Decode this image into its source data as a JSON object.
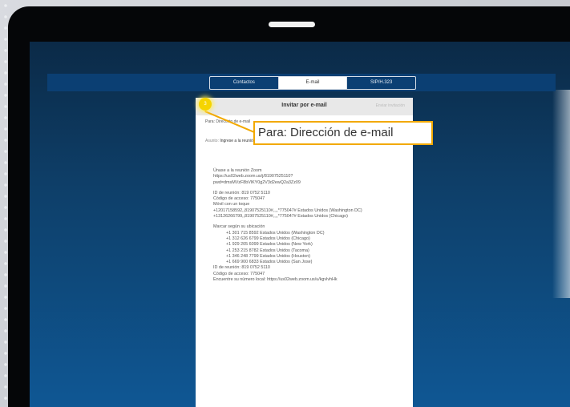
{
  "tabs": [
    "Contactos",
    "E-mail",
    "SIP/H.323"
  ],
  "active_tab": "E-mail",
  "dialog": {
    "title": "Invitar por e-mail",
    "action": "Enviar invitación",
    "to_label": "Para:",
    "to_placeholder": "Dirección de e-mail",
    "subject_label": "Asunto:",
    "subject_value": "Ingrese a la reunión Zoom"
  },
  "step_badge": "3",
  "callout": "Para: Dirección de e-mail",
  "message": {
    "p1": [
      "Únase a la reunión Zoom",
      "https://us02web.zoom.us/j/81907525110?",
      "pwd=dmsMVzF8bVlKY0g2V3d2ewQ2a3Zz09"
    ],
    "p2": [
      "ID de reunión: 819 0752 5110",
      "Código de acceso: 775047",
      "Móvil con un toque",
      "+12017158592,,81907525110#,,,,*775047# Estados Unidos (Washington DC)",
      "+13126266799,,81907525110#,,,,*775047# Estados Unidos (Chicago)"
    ],
    "p3_head": "Marcar según su ubicación",
    "p3_numbers": [
      "+1 301 715 8592 Estados Unidos (Washington DC)",
      "+1 312 626 6799 Estados Unidos (Chicago)",
      "+1 929 205 6099 Estados Unidos (New York)",
      "+1 253 215 8782 Estados Unidos (Tacoma)",
      "+1 346 248 7799 Estados Unidos (Houston)",
      "+1 669 900 6833 Estados Unidos (San Jose)"
    ],
    "p4": [
      "ID de reunión: 819 0752 5110",
      "Código de acceso: 775047",
      "Encuentre su número local: https://us02web.zoom.us/u/kgvlvhHk"
    ]
  }
}
